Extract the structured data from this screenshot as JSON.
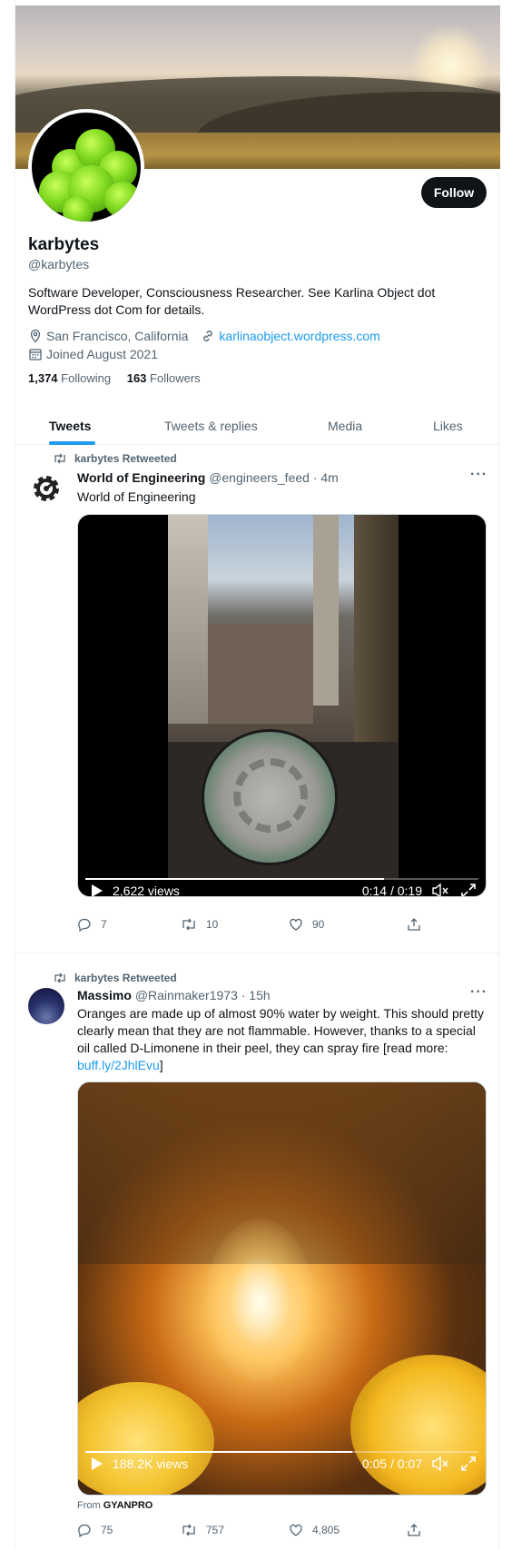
{
  "profile": {
    "name": "karbytes",
    "handle": "@karbytes",
    "follow_label": "Follow",
    "bio": "Software Developer, Consciousness Researcher. See Karlina Object dot WordPress dot Com for details.",
    "location": "San Francisco, California",
    "website": "karlinaobject.wordpress.com",
    "joined": "Joined August 2021",
    "following_count": "1,374",
    "following_label": "Following",
    "followers_count": "163",
    "followers_label": "Followers"
  },
  "tabs": [
    "Tweets",
    "Tweets & replies",
    "Media",
    "Likes"
  ],
  "tweets": [
    {
      "retweet_label": "karbytes Retweeted",
      "author_name": "World of Engineering",
      "author_handle": "@engineers_feed · 4m",
      "text": "World of Engineering",
      "video": {
        "views": "2,622 views",
        "time": "0:14 / 0:19",
        "progress": 0.76
      },
      "replies": "7",
      "retweets": "10",
      "likes": "90"
    },
    {
      "retweet_label": "karbytes Retweeted",
      "author_name": "Massimo",
      "author_handle": "@Rainmaker1973 · 15h",
      "text": "Oranges are made up of almost 90% water by weight. This should pretty clearly mean that they are not flammable. However, thanks to a special oil called D-Limonene in their peel, they can spray fire [read more: ",
      "link_text": "buff.ly/2JhlEvu",
      "text_end": "]",
      "video": {
        "views": "188.2K views",
        "time": "0:05 / 0:07",
        "progress": 0.68
      },
      "from_label": "From",
      "from_source": "GYANPRO",
      "replies": "75",
      "retweets": "757",
      "likes": "4,805"
    }
  ],
  "colors": {
    "accent": "#1d9bf0",
    "text": "#0f1419",
    "muted": "#536471"
  },
  "icons": [
    "location-icon",
    "link-icon",
    "calendar-icon",
    "retweet-icon",
    "reply-icon",
    "like-icon",
    "share-icon",
    "play-icon",
    "mute-icon",
    "fullscreen-icon",
    "more-icon"
  ]
}
